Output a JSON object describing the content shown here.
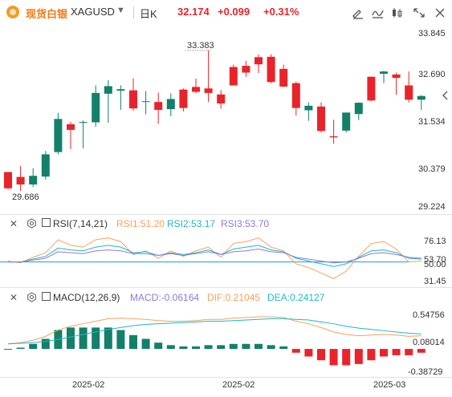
{
  "header": {
    "symbol_name": "现货白银",
    "symbol_code": "XAGUSD",
    "period": "日K",
    "last_price": "32.174",
    "change": "+0.099",
    "change_pct": "+0.31%",
    "icons": [
      "draw-tool-icon",
      "indicator-icon",
      "compare-icon",
      "fullscreen-icon",
      "close-icon"
    ]
  },
  "colors": {
    "up": "#e8242a",
    "down": "#13806a",
    "rsi1": "#f5a25d",
    "rsi2": "#1fb7c8",
    "rsi3": "#8f7ad6",
    "dif": "#f5a25d",
    "dea": "#1fb7c8",
    "macd_up": "#e8242a",
    "macd_down": "#13806a"
  },
  "price_axis": {
    "ticks": [
      "33.845",
      "32.690",
      "31.534",
      "30.379",
      "29.224"
    ],
    "current_price": "32.174",
    "high_marker": "33.383",
    "low_marker": "29.686"
  },
  "rsi": {
    "title": "RSI(7,14,21)",
    "rsi1": "RSI1:51.20",
    "rsi2": "RSI2:53.17",
    "rsi3": "RSI3:53.70",
    "ticks": [
      "76.13",
      "53.70",
      "50.00",
      "31.45"
    ]
  },
  "macd": {
    "title": "MACD(12,26,9)",
    "macd": "MACD:-0.06164",
    "dif": "DIF:0.21045",
    "dea": "DEA:0.24127",
    "ticks": [
      "0.54756",
      "0.08014",
      "-0.38729"
    ]
  },
  "x_axis": [
    "2025-02",
    "2025-02",
    "2025-03"
  ],
  "chart_data": {
    "type": "candlestick",
    "candles": [
      [
        30.15,
        30.15,
        29.72,
        29.69
      ],
      [
        30.02,
        30.31,
        29.82,
        29.65
      ],
      [
        29.82,
        30.25,
        30.05,
        29.75
      ],
      [
        30.03,
        30.71,
        30.62,
        29.95
      ],
      [
        30.68,
        31.72,
        31.56,
        30.62
      ],
      [
        31.42,
        31.48,
        31.27,
        30.76
      ],
      [
        31.48,
        31.52,
        31.48,
        30.78
      ],
      [
        31.47,
        32.45,
        32.25,
        31.35
      ],
      [
        32.23,
        32.59,
        32.43,
        31.46
      ],
      [
        32.31,
        32.45,
        32.35,
        31.8
      ],
      [
        32.32,
        32.64,
        31.84,
        31.78
      ],
      [
        32.03,
        32.3,
        32.03,
        31.68
      ],
      [
        32.01,
        32.26,
        31.8,
        31.43
      ],
      [
        31.82,
        32.24,
        32.09,
        31.63
      ],
      [
        32.34,
        32.37,
        31.85,
        31.76
      ],
      [
        32.41,
        32.63,
        32.28,
        32.24
      ],
      [
        32.37,
        33.38,
        32.25,
        32.01
      ],
      [
        32.21,
        32.33,
        31.97,
        31.83
      ],
      [
        32.94,
        33.0,
        32.45,
        32.45
      ],
      [
        32.97,
        33.1,
        32.79,
        32.68
      ],
      [
        33.2,
        33.27,
        33.01,
        32.78
      ],
      [
        33.21,
        33.28,
        32.54,
        32.51
      ],
      [
        32.89,
        33.0,
        32.42,
        32.4
      ],
      [
        32.51,
        32.55,
        31.85,
        31.65
      ],
      [
        31.79,
        32.0,
        31.91,
        31.51
      ],
      [
        31.89,
        32.0,
        31.24,
        31.2
      ],
      [
        31.1,
        31.54,
        31.07,
        30.9
      ],
      [
        31.25,
        31.6,
        31.73,
        31.2
      ],
      [
        31.69,
        32.0,
        31.99,
        31.53
      ],
      [
        32.68,
        32.69,
        32.05,
        32.03
      ],
      [
        32.76,
        32.84,
        32.82,
        32.51
      ],
      [
        32.74,
        32.79,
        32.65,
        32.2
      ],
      [
        32.45,
        32.82,
        32.07,
        32.0
      ],
      [
        32.07,
        32.19,
        32.17,
        31.8
      ]
    ],
    "candle_note_columns": [
      "open",
      "high",
      "close",
      "low"
    ],
    "rsi_series": [
      {
        "name": "RSI1",
        "values": [
          51,
          49,
          55,
          60,
          74,
          68,
          66,
          74,
          76,
          72,
          58,
          62,
          54,
          62,
          56,
          62,
          66,
          55,
          70,
          72,
          76,
          66,
          62,
          48,
          44,
          38,
          32,
          40,
          56,
          70,
          72,
          64,
          50,
          51
        ]
      },
      {
        "name": "RSI2",
        "values": [
          50,
          50,
          53,
          56,
          65,
          63,
          62,
          66,
          68,
          66,
          60,
          61,
          57,
          60,
          58,
          60,
          63,
          58,
          64,
          66,
          68,
          63,
          61,
          54,
          51,
          48,
          45,
          48,
          55,
          62,
          63,
          60,
          54,
          53
        ]
      },
      {
        "name": "RSI3",
        "values": [
          50,
          50,
          52,
          54,
          61,
          60,
          59,
          62,
          63,
          62,
          59,
          59,
          57,
          59,
          57,
          59,
          61,
          58,
          61,
          62,
          64,
          61,
          60,
          55,
          53,
          51,
          49,
          50,
          54,
          59,
          60,
          58,
          55,
          54
        ]
      }
    ],
    "macd_dif": [
      0.08,
      0.1,
      0.14,
      0.2,
      0.3,
      0.36,
      0.4,
      0.44,
      0.48,
      0.49,
      0.48,
      0.47,
      0.45,
      0.44,
      0.44,
      0.45,
      0.47,
      0.47,
      0.49,
      0.5,
      0.51,
      0.51,
      0.5,
      0.44,
      0.4,
      0.34,
      0.27,
      0.23,
      0.21,
      0.22,
      0.23,
      0.22,
      0.2,
      0.21
    ],
    "macd_dea": [
      0.08,
      0.09,
      0.1,
      0.12,
      0.15,
      0.19,
      0.23,
      0.27,
      0.31,
      0.34,
      0.37,
      0.39,
      0.4,
      0.41,
      0.42,
      0.43,
      0.44,
      0.44,
      0.45,
      0.46,
      0.47,
      0.48,
      0.48,
      0.47,
      0.46,
      0.43,
      0.4,
      0.36,
      0.33,
      0.31,
      0.29,
      0.27,
      0.25,
      0.24
    ],
    "macd_hist": [
      0.0,
      0.02,
      0.08,
      0.16,
      0.3,
      0.34,
      0.34,
      0.34,
      0.34,
      0.3,
      0.22,
      0.16,
      0.1,
      0.06,
      0.04,
      0.04,
      0.06,
      0.06,
      0.08,
      0.08,
      0.08,
      0.06,
      0.04,
      -0.06,
      -0.12,
      -0.18,
      -0.26,
      -0.26,
      -0.24,
      -0.18,
      -0.12,
      -0.1,
      -0.1,
      -0.06
    ]
  }
}
